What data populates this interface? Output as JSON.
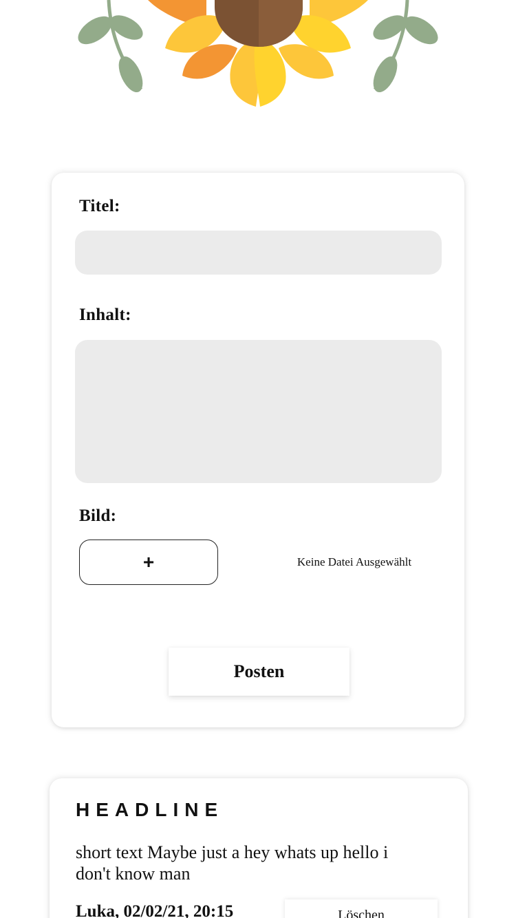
{
  "form": {
    "title_label": "Titel:",
    "content_label": "Inhalt:",
    "image_label": "Bild:",
    "file_button_label": "+",
    "file_status": "Keine Datei Ausgewählt",
    "submit_label": "Posten",
    "title_value": "",
    "content_value": ""
  },
  "post": {
    "headline": "HEADLINE",
    "text": "short text Maybe just a hey whats up hello i don't know man",
    "meta": "Luka, 02/02/21, 20:15",
    "delete_label": "Löschen"
  },
  "colors": {
    "field_bg": "#ebebeb",
    "petal_yellow": "#fdc63a",
    "petal_orange": "#f39533",
    "flower_center": "#7b5233",
    "leaf_green": "#93ab8a"
  }
}
